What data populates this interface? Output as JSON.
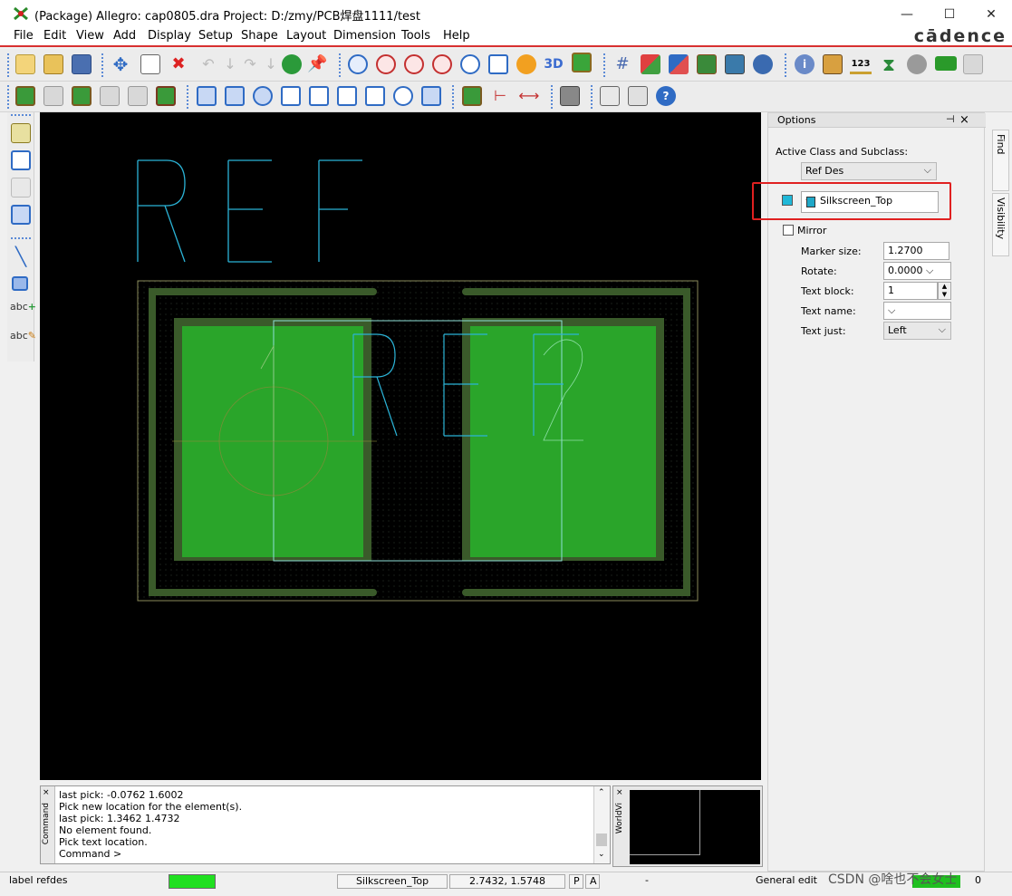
{
  "window": {
    "title": "(Package) Allegro: cap0805.dra  Project: D:/zmy/PCB焊盘1111/test",
    "minimize_glyph": "—",
    "maximize_glyph": "☐",
    "close_glyph": "✕"
  },
  "menu": {
    "items": [
      "File",
      "Edit",
      "View",
      "Add",
      "Display",
      "Setup",
      "Shape",
      "Layout",
      "Dimension",
      "Tools",
      "Help"
    ],
    "brand": "cādence"
  },
  "options": {
    "header": "Options",
    "pin_glyph": "⊣",
    "close_glyph": "×",
    "active_class_label": "Active Class and Subclass:",
    "class_value": "Ref Des",
    "subclass_value": "Silkscreen_Top",
    "mirror_label": "Mirror",
    "marker_size_label": "Marker size:",
    "marker_size_value": "1.2700",
    "rotate_label": "Rotate:",
    "rotate_value": "0.0000",
    "text_block_label": "Text block:",
    "text_block_value": "1",
    "text_name_label": "Text name:",
    "text_name_value": "",
    "text_just_label": "Text just:",
    "text_just_value": "Left"
  },
  "side_tabs": {
    "find": "Find",
    "visibility": "Visibility"
  },
  "canvas": {
    "ref_text_large": "REF",
    "ref_text_small": "REF",
    "pin1_label": "1",
    "pin2_label": "2"
  },
  "command": {
    "side_label": "Command",
    "lines": [
      "last pick:  -0.0762 1.6002",
      "Pick new location for the element(s).",
      "last pick:  1.3462 1.4732",
      "No element found.",
      "Pick text location.",
      "Command >"
    ]
  },
  "worldview": {
    "side_label": "WorldVi"
  },
  "status": {
    "command": "label refdes",
    "subclass": "Silkscreen_Top",
    "coords": "2.7432, 1.5748",
    "p_btn": "P",
    "a_btn": "A",
    "dash": "-",
    "mode": "General edit",
    "watermark": "CSDN @啥也不会女士",
    "zero": "0"
  },
  "colors": {
    "accent_red": "#d83030",
    "pad_green": "#2aa52a",
    "soldermask_dark": "#3a5a2a",
    "silk_cyan": "#2bb3d6",
    "assembly_cyan": "#8fe0d8",
    "canvas_bg": "#000000"
  }
}
